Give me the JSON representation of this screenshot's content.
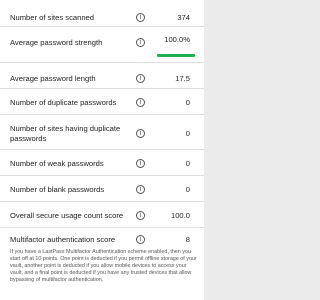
{
  "rows": [
    {
      "label": "Number of sites scanned",
      "value": "374"
    },
    {
      "label": "Average password strength",
      "value": "100.0%"
    },
    {
      "label": "Average password length",
      "value": "17.5"
    },
    {
      "label": "Number of duplicate passwords",
      "value": "0"
    },
    {
      "label": "Number of sites having duplicate passwords",
      "value": "0"
    },
    {
      "label": "Number of weak passwords",
      "value": "0"
    },
    {
      "label": "Number of blank passwords",
      "value": "0"
    },
    {
      "label": "Overall secure usage count score",
      "value": "100.0"
    },
    {
      "label": "Multifactor authentication score",
      "value": "8"
    }
  ],
  "strength_bar_fraction": 1.0,
  "info_icon": "info-icon",
  "footnote": "If you have a LastPass Multifactor Authentication scheme enabled, then you start off at 10 points. One point is deducted if you permit offline storage of your vault, another point is deducted if you allow mobile devices to access your vault, and a final point is deducted if you have any trusted devices that allow bypassing of multifactor authentication.",
  "colors": {
    "accent": "#1fb254",
    "divider": "#dddddd"
  }
}
